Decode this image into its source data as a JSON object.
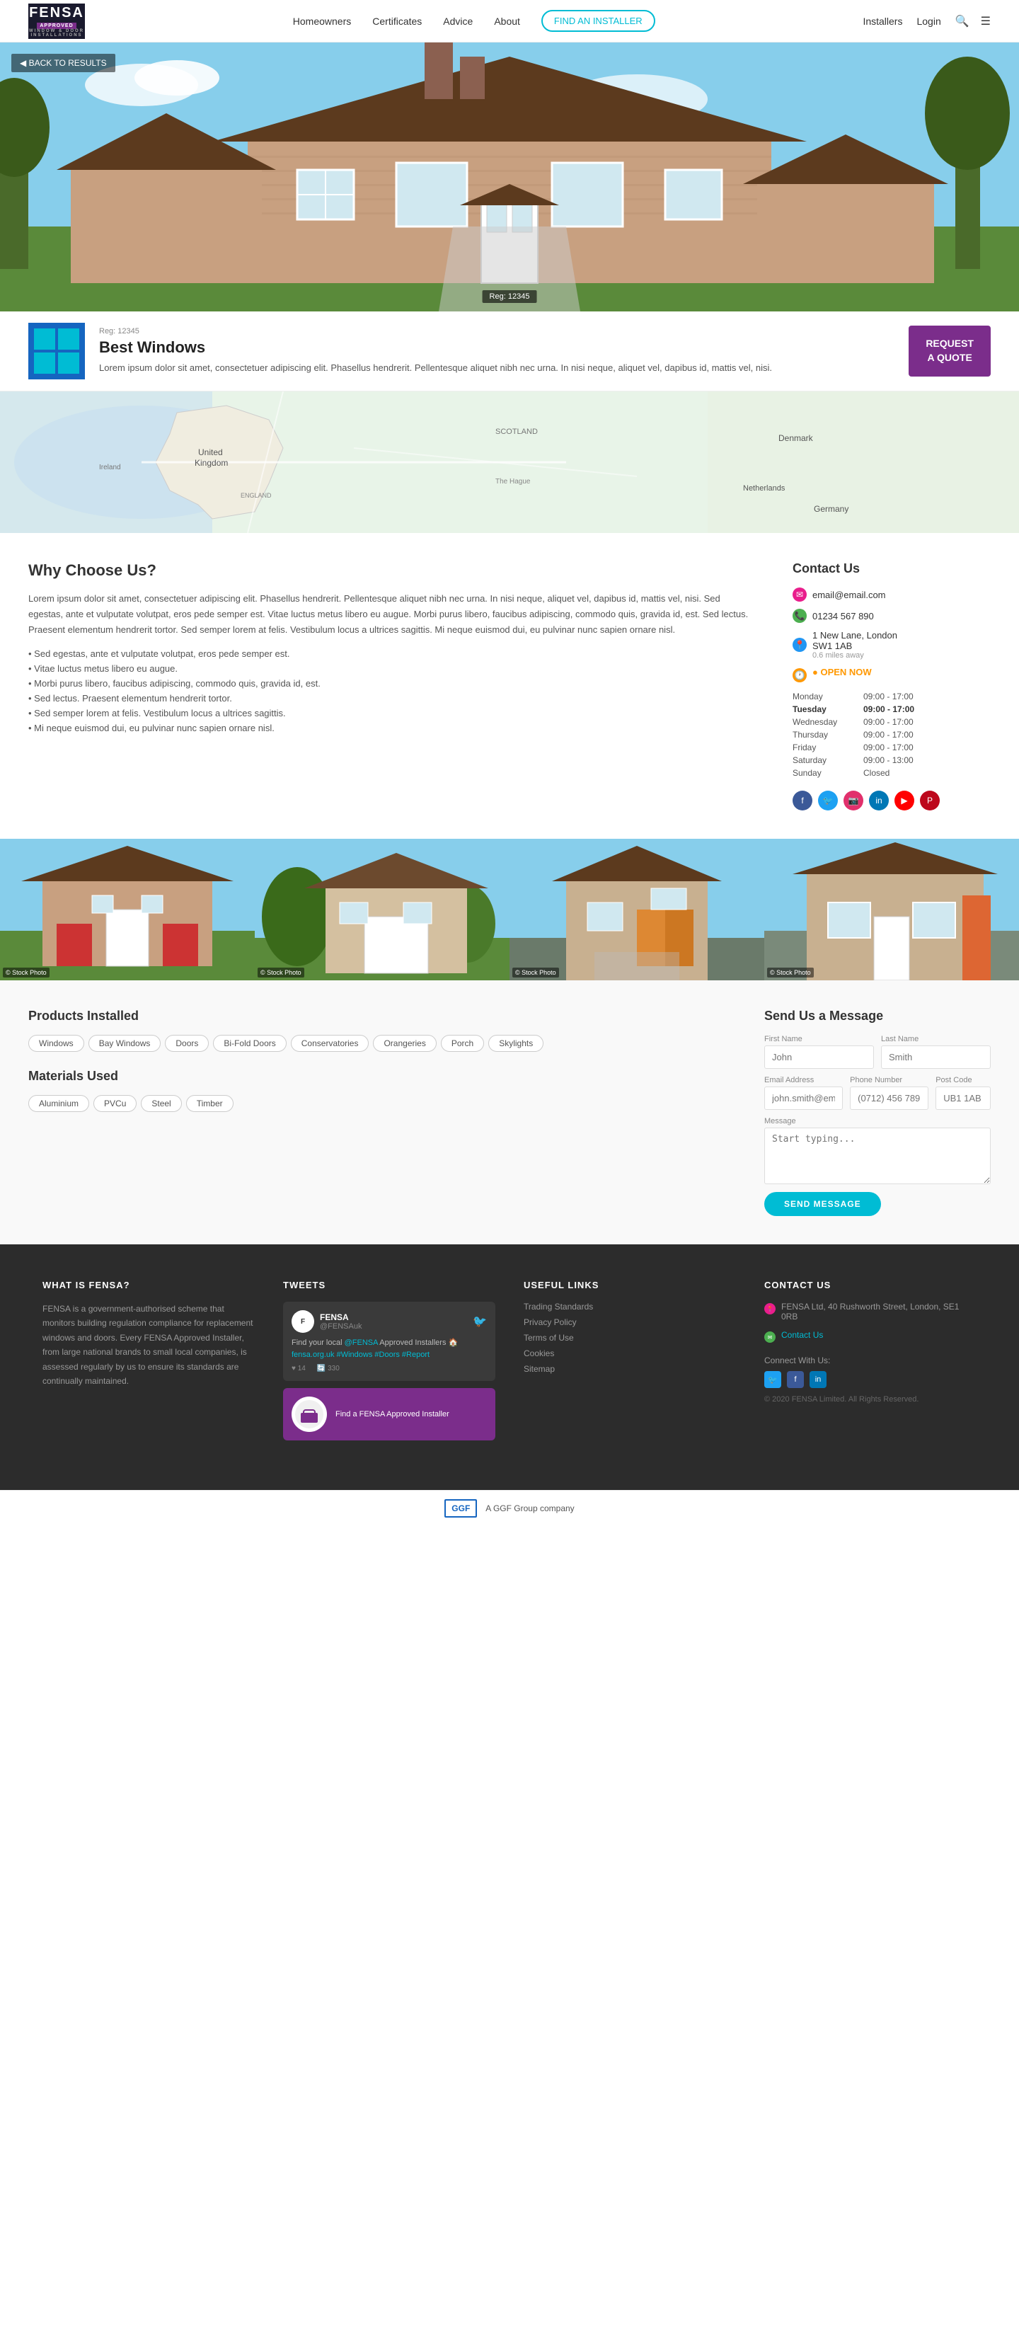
{
  "header": {
    "logo": "FENSA",
    "logo_sub1": "APPROVED",
    "logo_sub2": "WINDOW & DOOR INSTALLATIONS",
    "nav": [
      {
        "label": "Homeowners",
        "href": "#"
      },
      {
        "label": "Certificates",
        "href": "#"
      },
      {
        "label": "Advice",
        "href": "#"
      },
      {
        "label": "About",
        "href": "#"
      }
    ],
    "find_installer_btn": "FIND AN INSTALLER",
    "installers_link": "Installers",
    "login_link": "Login"
  },
  "hero": {
    "back_label": "◀ BACK TO RESULTS",
    "reg": "Reg: 12345"
  },
  "business": {
    "name": "Best Windows",
    "description": "Lorem ipsum dolor sit amet, consectetuer adipiscing elit. Phasellus hendrerit. Pellentesque aliquet nibh nec urna. In nisi neque, aliquet vel, dapibus id, mattis vel, nisi.",
    "request_quote": "REQUEST\nA QUOTE"
  },
  "contact_us": {
    "title": "Contact Us",
    "email": "email@email.com",
    "phone": "01234 567 890",
    "address": "1 New Lane, London\nSW1 1AB",
    "distance": "0.6 miles away",
    "open_now": "● OPEN NOW",
    "hours": [
      {
        "day": "Monday",
        "time": "09:00 - 17:00",
        "today": false
      },
      {
        "day": "Tuesday",
        "time": "09:00 - 17:00",
        "today": true
      },
      {
        "day": "Wednesday",
        "time": "09:00 - 17:00",
        "today": false
      },
      {
        "day": "Thursday",
        "time": "09:00 - 17:00",
        "today": false
      },
      {
        "day": "Friday",
        "time": "09:00 - 17:00",
        "today": false
      },
      {
        "day": "Saturday",
        "time": "09:00 - 13:00",
        "today": false
      },
      {
        "day": "Sunday",
        "time": "Closed",
        "today": false
      }
    ]
  },
  "why_choose": {
    "title": "Why Choose Us?",
    "intro": "Lorem ipsum dolor sit amet, consectetuer adipiscing elit. Phasellus hendrerit. Pellentesque aliquet nibh nec urna. In nisi neque, aliquet vel, dapibus id, mattis vel, nisi. Sed egestas, ante et vulputate volutpat, eros pede semper est. Vitae luctus metus libero eu augue. Morbi purus libero, faucibus adipiscing, commodo quis, gravida id, est. Sed lectus. Praesent elementum hendrerit tortor. Sed semper lorem at felis. Vestibulum locus a ultrices sagittis. Mi neque euismod dui, eu pulvinar nunc sapien ornare nisl.",
    "bullets": [
      "Sed egestas, ante et vulputate volutpat, eros pede semper est.",
      "Vitae luctus metus libero eu augue.",
      "Morbi purus libero, faucibus adipiscing, commodo quis, gravida id, est.",
      "Sed lectus. Praesent elementum hendrerit tortor.",
      "Sed semper lorem at felis. Vestibulum locus a ultrices sagittis.",
      "Mi neque euismod dui, eu pulvinar nunc sapien ornare nisl."
    ]
  },
  "products": {
    "title": "Products Installed",
    "tags": [
      "Windows",
      "Bay Windows",
      "Doors",
      "Bi-Fold Doors",
      "Conservatories",
      "Orangeries",
      "Porch",
      "Skylights"
    ]
  },
  "materials": {
    "title": "Materials Used",
    "tags": [
      "Aluminium",
      "PVCu",
      "Steel",
      "Timber"
    ]
  },
  "send_message": {
    "title": "Send Us a Message",
    "fields": {
      "first_name_label": "First Name",
      "first_name_placeholder": "John",
      "last_name_label": "Last Name",
      "last_name_placeholder": "Smith",
      "email_label": "Email Address",
      "email_placeholder": "john.smith@email.com",
      "phone_label": "Phone Number",
      "phone_placeholder": "(0712) 456 789",
      "postcode_label": "Post Code",
      "postcode_placeholder": "UB1 1AB",
      "message_label": "Message",
      "message_placeholder": "Start typing..."
    },
    "send_btn": "SEND MESSAGE"
  },
  "footer": {
    "what_is_fensa": {
      "title": "WHAT IS FENSA?",
      "text": "FENSA is a government-authorised scheme that monitors building regulation compliance for replacement windows and doors. Every FENSA Approved Installer, from large national brands to small local companies, is assessed regularly by us to ensure its standards are continually maintained."
    },
    "tweets": {
      "title": "TWEETS",
      "handle": "@FENSAuk",
      "name": "FENSA",
      "tweet_text": "Find your local @FENSA Approved Installers 🏠 fensa.org.uk #Windows #Doors #Report",
      "banner_text": "Find a FENSA Approved Installer",
      "like_count": "♥ 14",
      "retweet_count": "🔄 330"
    },
    "useful_links": {
      "title": "USEFUL LINKS",
      "links": [
        "Trading Standards",
        "Privacy Policy",
        "Terms of Use",
        "Cookies",
        "Sitemap"
      ]
    },
    "contact": {
      "title": "CONTACT US",
      "address": "FENSA Ltd, 40 Rushworth Street, London, SE1 0RB",
      "contact_link": "Contact Us",
      "connect_label": "Connect With Us:",
      "copy": "© 2020 FENSA Limited. All Rights Reserved."
    }
  },
  "ggf": {
    "logo": "GGF",
    "text": "A GGF Group company"
  }
}
